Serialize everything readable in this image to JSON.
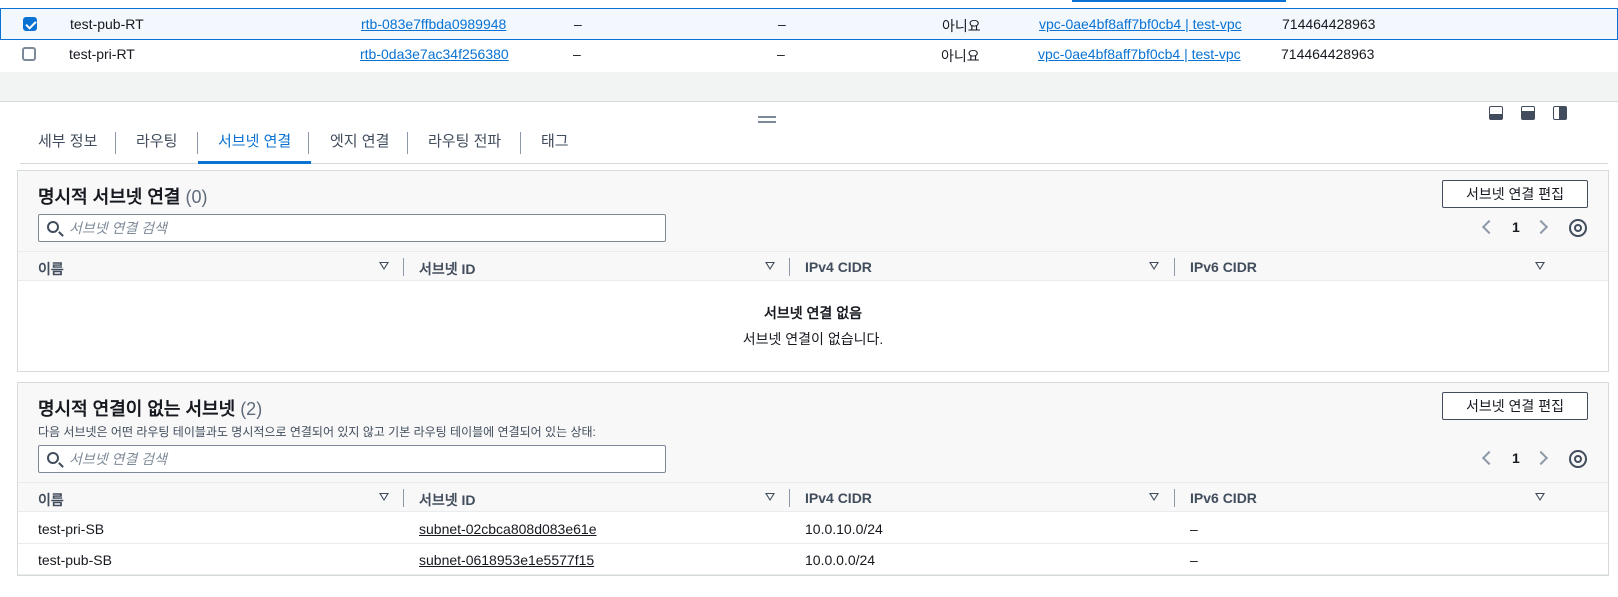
{
  "route_tables": {
    "rows": [
      {
        "selected": true,
        "name": "test-pub-RT",
        "route_table_id": "rtb-083e7ffbda0989948",
        "explicit_subnet": "–",
        "edge_assoc": "–",
        "main": "아니요",
        "vpc": "vpc-0ae4bf8aff7bf0cb4 | test-vpc",
        "owner": "714464428963"
      },
      {
        "selected": false,
        "name": "test-pri-RT",
        "route_table_id": "rtb-0da3e7ac34f256380",
        "explicit_subnet": "–",
        "edge_assoc": "–",
        "main": "아니요",
        "vpc": "vpc-0ae4bf8aff7bf0cb4 | test-vpc",
        "owner": "714464428963"
      }
    ]
  },
  "tabs": [
    {
      "label": "세부 정보",
      "active": false
    },
    {
      "label": "라우팅",
      "active": false
    },
    {
      "label": "서브넷 연결",
      "active": true
    },
    {
      "label": "엣지 연결",
      "active": false
    },
    {
      "label": "라우팅 전파",
      "active": false
    },
    {
      "label": "태그",
      "active": false
    }
  ],
  "explicit": {
    "title": "명시적 서브넷 연결",
    "count": "(0)",
    "edit_button": "서브넷 연결 편집",
    "search_placeholder": "서브넷 연결 검색",
    "page": "1",
    "columns": [
      "이름",
      "서브넷 ID",
      "IPv4 CIDR",
      "IPv6 CIDR"
    ],
    "empty_title": "서브넷 연결 없음",
    "empty_desc": "서브넷 연결이 없습니다."
  },
  "implicit": {
    "title": "명시적 연결이 없는 서브넷",
    "count": "(2)",
    "description": "다음 서브넷은 어떤 라우팅 테이블과도 명시적으로 연결되어 있지 않고 기본 라우팅 테이블에 연결되어 있는 상태:",
    "edit_button": "서브넷 연결 편집",
    "search_placeholder": "서브넷 연결 검색",
    "page": "1",
    "columns": [
      "이름",
      "서브넷 ID",
      "IPv4 CIDR",
      "IPv6 CIDR"
    ],
    "rows": [
      {
        "name": "test-pri-SB",
        "subnet_id": "subnet-02cbca808d083e61e",
        "ipv4": "10.0.10.0/24",
        "ipv6": "–"
      },
      {
        "name": "test-pub-SB",
        "subnet_id": "subnet-0618953e1e5577f15",
        "ipv4": "10.0.0.0/24",
        "ipv6": "–"
      }
    ]
  },
  "colors": {
    "link": "#0972d3",
    "selected_row_bg": "#f2f8fd",
    "header_bg": "#f8f8f8"
  },
  "icons": [
    "checkbox-checked-icon",
    "checkbox-icon",
    "drag-handle-icon",
    "panel-bottom-icon",
    "panel-middle-icon",
    "panel-side-icon",
    "search-icon",
    "chevron-left-icon",
    "chevron-right-icon",
    "gear-icon",
    "sort-icon"
  ]
}
